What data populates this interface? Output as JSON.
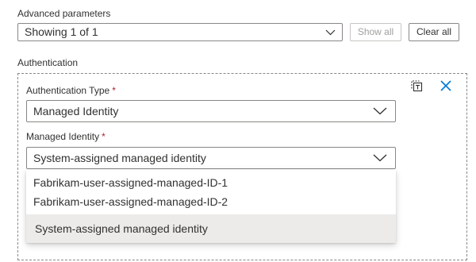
{
  "advanced": {
    "label": "Advanced parameters",
    "select_value": "Showing 1 of 1",
    "show_all_label": "Show all",
    "clear_all_label": "Clear all"
  },
  "authentication": {
    "section_label": "Authentication",
    "type_label": "Authentication Type",
    "type_value": "Managed Identity",
    "identity_label": "Managed Identity",
    "identity_value": "System-assigned managed identity",
    "required_marker": "*",
    "options": [
      "Fabrikam-user-assigned-managed-ID-1",
      "Fabrikam-user-assigned-managed-ID-2",
      "System-assigned managed identity"
    ],
    "selected_option_index": 2
  },
  "colors": {
    "accent": "#0078d4",
    "required": "#a4262c",
    "border": "#8a8886",
    "selected_bg": "#edebe9",
    "disabled_text": "#a19f9d"
  },
  "icons": {
    "copy_button": "copy-icon",
    "close_button": "close-icon",
    "dropdown": "chevron-down-icon"
  }
}
